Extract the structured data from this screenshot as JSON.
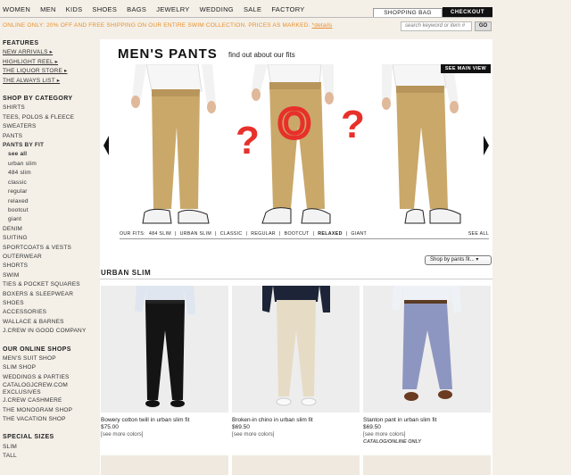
{
  "topnav": [
    "WOMEN",
    "MEN",
    "KIDS",
    "SHOES",
    "BAGS",
    "JEWELRY",
    "WEDDING",
    "SALE",
    "FACTORY"
  ],
  "bag_label": "SHOPPING BAG",
  "checkout_label": "CHECKOUT",
  "promo": {
    "text": "ONLINE ONLY: 20% OFF AND FREE SHIPPING ON OUR ENTIRE SWIM COLLECTION. PRICES AS MARKED.",
    "link": "*details"
  },
  "search": {
    "placeholder": "search keyword or item #",
    "go": "GO"
  },
  "sidebar": {
    "features_head": "FEATURES",
    "features": [
      "NEW ARRIVALS ▸",
      "HIGHLIGHT REEL ▸",
      "THE LIQUOR STORE ▸",
      "THE ALWAYS LIST ▸"
    ],
    "category_head": "SHOP BY CATEGORY",
    "cat_top": [
      "SHIRTS",
      "TEES, POLOS & FLEECE",
      "SWEATERS",
      "PANTS"
    ],
    "fit_head": "PANTS BY FIT",
    "fits": [
      "see all",
      "urban slim",
      "484 slim",
      "classic",
      "regular",
      "relaxed",
      "bootcut",
      "giant"
    ],
    "cat_bottom": [
      "DENIM",
      "SUITING",
      "SPORTCOATS & VESTS",
      "OUTERWEAR",
      "SHORTS",
      "SWIM",
      "TIES & POCKET SQUARES",
      "BOXERS & SLEEPWEAR",
      "SHOES",
      "ACCESSORIES",
      "WALLACE & BARNES",
      "J.CREW IN GOOD COMPANY"
    ],
    "shops_head": "OUR ONLINE SHOPS",
    "shops": [
      "MEN'S SUIT SHOP",
      "SLIM SHOP",
      "WEDDINGS & PARTIES",
      "CATALOGJCREW.COM EXCLUSIVES",
      "J.CREW CASHMERE",
      "THE MONOGRAM SHOP",
      "THE VACATION SHOP"
    ],
    "special_head": "SPECIAL SIZES",
    "special": [
      "SLIM",
      "TALL"
    ]
  },
  "main": {
    "title": "MEN'S PANTS",
    "subtitle": "find out about our fits",
    "see_main_view": "SEE MAIN VIEW",
    "fits_bar": {
      "label": "OUR FITS:",
      "items": [
        "484 SLIM",
        "URBAN SLIM",
        "CLASSIC",
        "REGULAR",
        "BOOTCUT",
        "RELAXED",
        "GIANT"
      ],
      "see_all": "SEE ALL"
    },
    "sort_label": "Shop by pants fit... ▾",
    "section_title": "URBAN SLIM",
    "products": [
      {
        "name": "Bowery cotton twill in urban slim fit",
        "price": "$75.00",
        "colors": "[see more colors]",
        "note": ""
      },
      {
        "name": "Broken-in chino in urban slim fit",
        "price": "$69.50",
        "colors": "[see more colors]",
        "note": ""
      },
      {
        "name": "Stanton pant in urban slim fit",
        "price": "$69.50",
        "colors": "[see more colors]",
        "note": "CATALOG/ONLINE ONLY"
      }
    ]
  }
}
